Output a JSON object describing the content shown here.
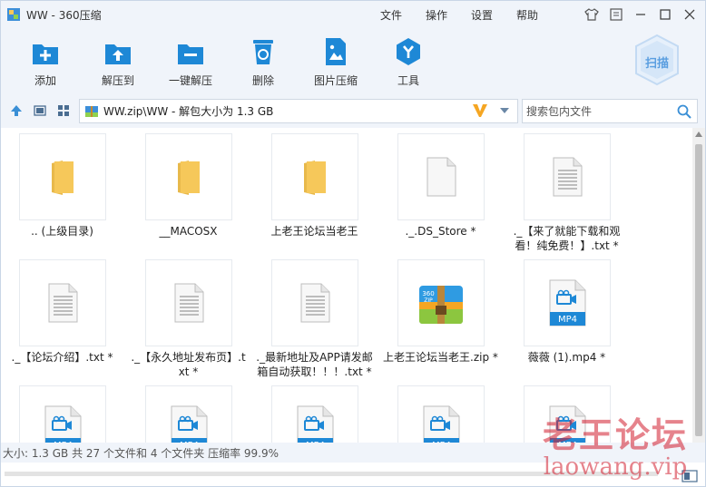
{
  "window": {
    "title": "WW - 360压缩"
  },
  "menu": {
    "file": "文件",
    "operate": "操作",
    "settings": "设置",
    "help": "帮助"
  },
  "toolbar": {
    "add": "添加",
    "extract_to": "解压到",
    "one_click_extract": "一键解压",
    "delete": "删除",
    "image_compress": "图片压缩",
    "tools": "工具",
    "scan": "扫描"
  },
  "address": {
    "path": "WW.zip\\WW - 解包大小为 1.3 GB"
  },
  "search": {
    "placeholder": "搜索包内文件"
  },
  "files": [
    {
      "name": ".. (上级目录)",
      "icon": "folder-icon"
    },
    {
      "name": "__MACOSX",
      "icon": "folder-icon"
    },
    {
      "name": "上老王论坛当老王",
      "icon": "folder-icon"
    },
    {
      "name": "._.DS_Store *",
      "icon": "blank-file-icon"
    },
    {
      "name": "._【来了就能下载和观看！纯免费！】.txt *",
      "icon": "text-file-icon"
    },
    {
      "name": "._【论坛介绍】.txt *",
      "icon": "text-file-icon"
    },
    {
      "name": "._【永久地址发布页】.txt *",
      "icon": "text-file-icon"
    },
    {
      "name": "._最新地址及APP请发邮箱自动获取！！！.txt *",
      "icon": "text-file-icon"
    },
    {
      "name": "上老王论坛当老王.zip *",
      "icon": "zip-archive-icon"
    },
    {
      "name": "薇薇 (1).mp4 *",
      "icon": "mp4-file-icon"
    },
    {
      "name": "",
      "icon": "mp4-file-icon"
    },
    {
      "name": "",
      "icon": "mp4-file-icon"
    },
    {
      "name": "",
      "icon": "mp4-file-icon"
    },
    {
      "name": "",
      "icon": "mp4-file-icon"
    },
    {
      "name": "",
      "icon": "mp4-file-icon"
    }
  ],
  "labels": {
    "mp4": "MP4",
    "zip_top": "360",
    "zip_bottom": "ZIP"
  },
  "status": {
    "text": "大小: 1.3 GB 共 27 个文件和 4 个文件夹 压缩率 99.9%"
  },
  "watermark": {
    "line1": "老王论坛",
    "line2": "laowang.vip"
  },
  "colors": {
    "accent": "#1e88d6",
    "toolbar_bg": "#f0f4fa",
    "folder": "#f6c85a",
    "watermark": "#d21e2d"
  }
}
